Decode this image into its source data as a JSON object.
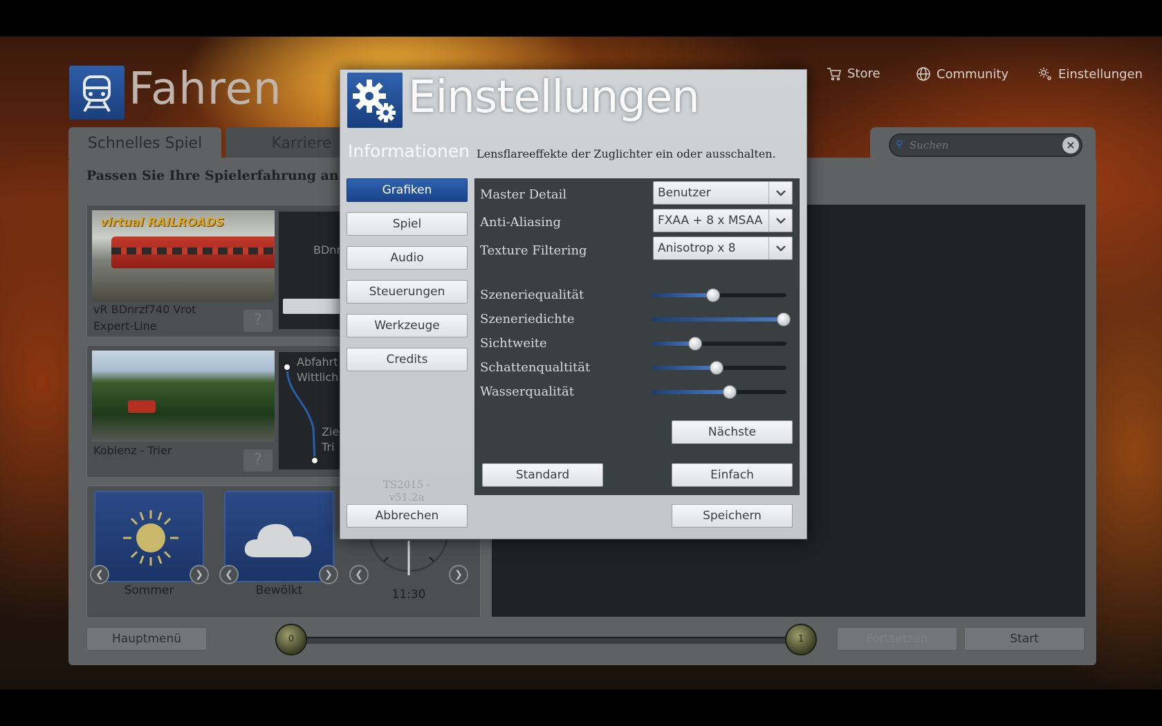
{
  "header": {
    "title": "Fahren",
    "nav": [
      {
        "label": "Store",
        "icon": "cart-icon"
      },
      {
        "label": "Community",
        "icon": "globe-icon"
      },
      {
        "label": "Einstellungen",
        "icon": "gear-icon"
      }
    ]
  },
  "tabs": [
    {
      "label": "Schnelles Spiel",
      "active": true
    },
    {
      "label": "Karriere",
      "active": false
    }
  ],
  "subtitle": "Passen Sie Ihre Spielerfahrung an.",
  "search": {
    "placeholder": "Suchen"
  },
  "cards": {
    "loco": {
      "brand": "virtual RAILROADS",
      "name": "vR BDnrzf740 Vrot",
      "line": "Expert-Line",
      "preview_label": "BDnr"
    },
    "route": {
      "name": "Koblenz - Trier",
      "from_label": "Abfahrt",
      "from_place": "Wittlich",
      "to_label": "Zie",
      "to_place": "Tri"
    }
  },
  "conditions": {
    "season": "Sommer",
    "weather": "Bewölkt",
    "time": "11:30"
  },
  "bottom": {
    "main_menu": "Hauptmenü",
    "continue": "Fortsetzen",
    "start": "Start",
    "slider_min": "0",
    "slider_max": "1"
  },
  "dialog": {
    "title": "Einstellungen",
    "info_heading": "Informationen",
    "info_text": "Lensflareeffekte der Zuglichter ein oder ausschalten.",
    "sidebar": [
      "Grafiken",
      "Spiel",
      "Audio",
      "Steuerungen",
      "Werkzeuge",
      "Credits"
    ],
    "active_sidebar": "Grafiken",
    "version": "TS2015 - v51.2a",
    "selects": [
      {
        "label": "Master Detail",
        "value": "Benutzer"
      },
      {
        "label": "Anti-Aliasing",
        "value": "FXAA + 8 x MSAA"
      },
      {
        "label": "Texture Filtering",
        "value": "Anisotrop x 8"
      }
    ],
    "sliders": [
      {
        "label": "Szeneriequalität",
        "level": 0.45
      },
      {
        "label": "Szeneriedichte",
        "level": 1.0
      },
      {
        "label": "Sichtweite",
        "level": 0.31
      },
      {
        "label": "Schattenqualtität",
        "level": 0.48
      },
      {
        "label": "Wasserqualität",
        "level": 0.58
      }
    ],
    "next": "Nächste",
    "standard": "Standard",
    "simple": "Einfach",
    "cancel": "Abbrechen",
    "save": "Speichern"
  }
}
